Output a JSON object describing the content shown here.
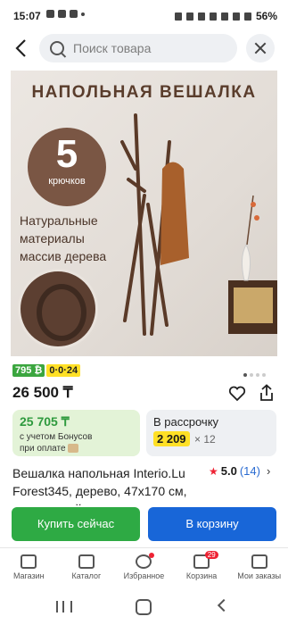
{
  "status": {
    "time": "15:07",
    "battery": "56%"
  },
  "search": {
    "placeholder": "Поиск товара"
  },
  "hero": {
    "title": "НАПОЛЬНАЯ ВЕШАЛКА",
    "badge_number": "5",
    "badge_label": "крючков",
    "feature_lines": [
      "Натуральные",
      "материалы",
      "массив дерева"
    ],
    "pager": {
      "total": 4,
      "active": 1
    }
  },
  "badges": {
    "green": "795 ₿",
    "yellow": "0·0·24"
  },
  "price": "26 500 ₸",
  "bonus": {
    "value": "25 705 ₸",
    "line1": "с учетом Бонусов",
    "line2": "при оплате"
  },
  "installment": {
    "label": "В рассрочку",
    "amount": "2 209",
    "multiplier": "× 12"
  },
  "product_title": "Вешалка напольная Interio.Lu Forest345, дерево, 47x170 см, коричневый",
  "rating": {
    "score": "5.0",
    "count": "(14)"
  },
  "actions": {
    "buy_now": "Купить сейчас",
    "to_cart": "В корзину"
  },
  "tabs": [
    {
      "label": "Магазин",
      "icon": "store-icon"
    },
    {
      "label": "Каталог",
      "icon": "catalog-icon"
    },
    {
      "label": "Избранное",
      "icon": "heart-icon"
    },
    {
      "label": "Корзина",
      "icon": "cart-icon",
      "count": "29"
    },
    {
      "label": "Мои заказы",
      "icon": "orders-icon"
    }
  ]
}
